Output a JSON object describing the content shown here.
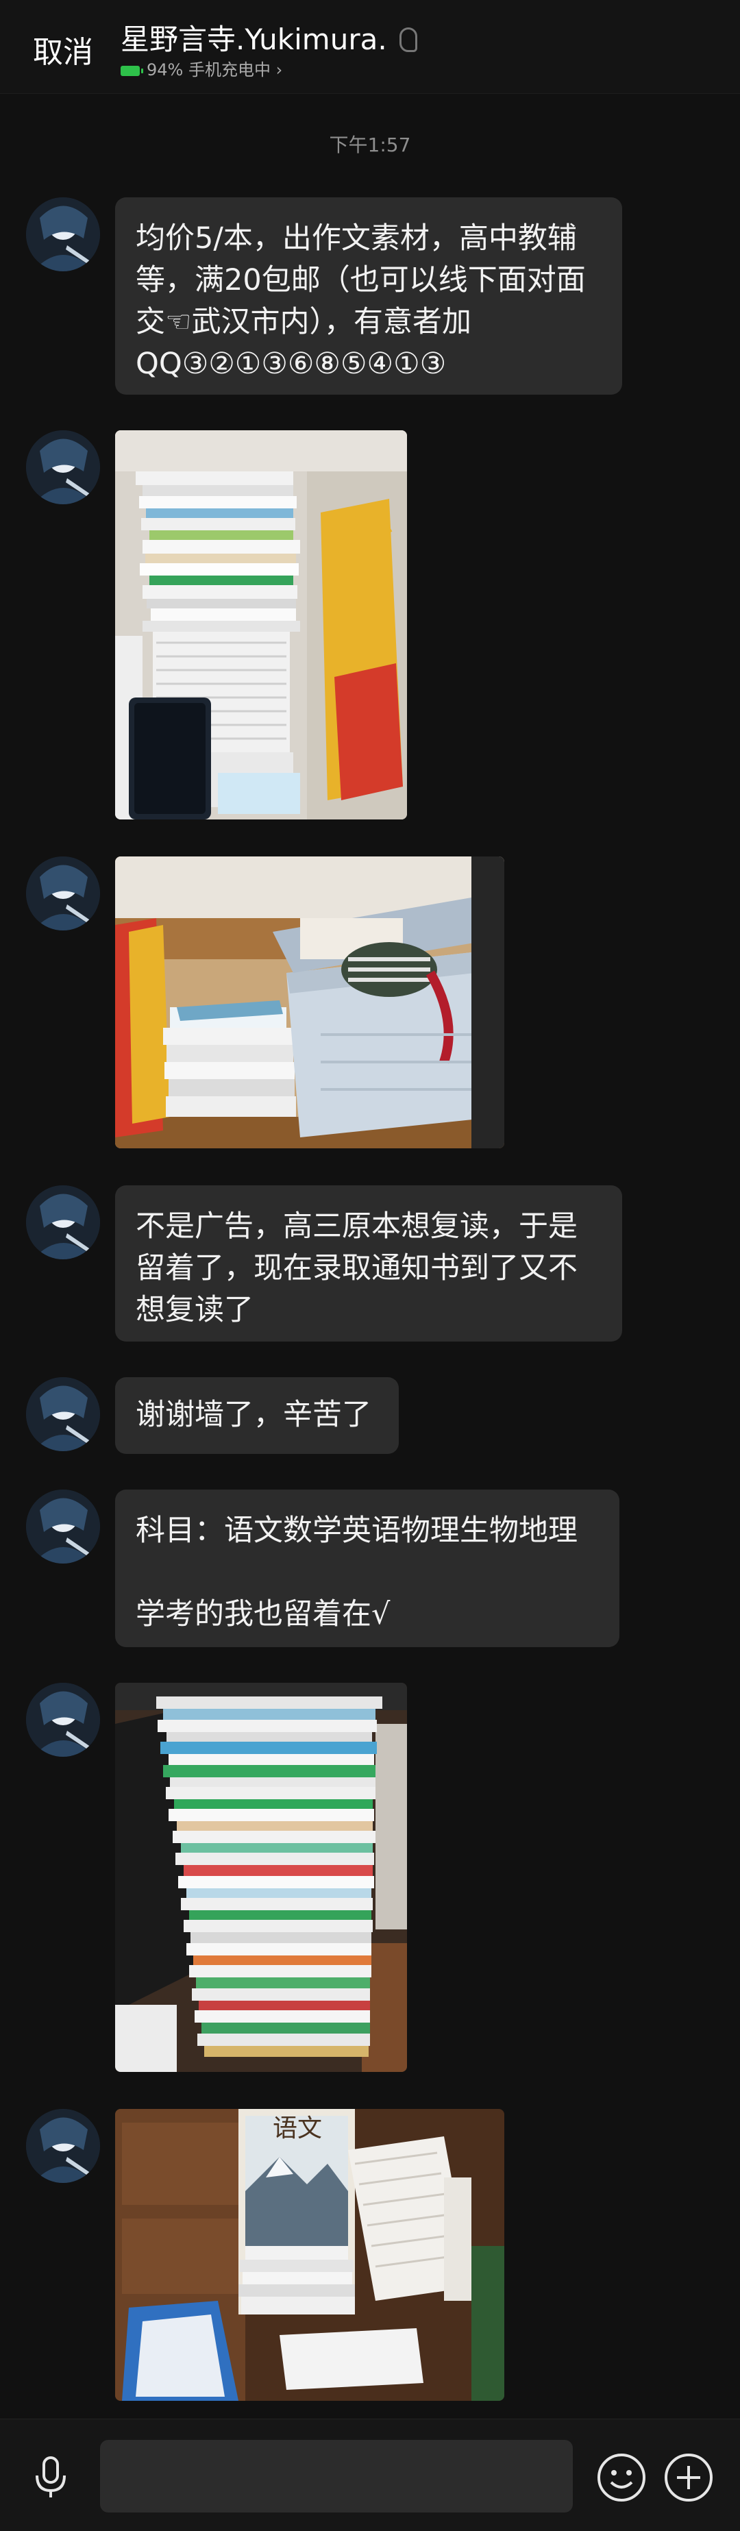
{
  "header": {
    "cancel_label": "取消",
    "title": "星野言寺.Yukimura.",
    "battery_text": "94%",
    "status_text": "手机充电中",
    "status_arrow": "›"
  },
  "timestamp": "下午1:57",
  "messages": [
    {
      "type": "text",
      "lines": [
        "均价5/本，出作文素材，高中教辅",
        "等，满20包邮（也可以线下面对面",
        "交☜武汉市内），有意者加",
        "QQ③②①③⑥⑧⑤④①③"
      ]
    },
    {
      "type": "image",
      "icon": "book-stack-photo-1"
    },
    {
      "type": "image",
      "icon": "book-box-photo"
    },
    {
      "type": "text",
      "lines": [
        "不是广告，高三原本想复读，于是",
        "留着了，现在录取通知书到了又不",
        "想复读了"
      ]
    },
    {
      "type": "text",
      "lines": [
        "谢谢墙了，辛苦了"
      ]
    },
    {
      "type": "text",
      "lines": [
        "科目：语文数学英语物理生物地理",
        "",
        "学考的我也留着在√"
      ]
    },
    {
      "type": "image",
      "icon": "book-stack-photo-2"
    },
    {
      "type": "image",
      "icon": "chinese-textbook-photo",
      "caption": "语文"
    }
  ],
  "bottom_bar": {
    "mic_icon": "microphone-icon",
    "emoji_icon": "emoji-icon",
    "plus_icon": "plus-icon"
  },
  "colors": {
    "background": "#111111",
    "bubble": "#2c2c2c",
    "battery": "#2ec14a",
    "timestamp": "#8e8e8e"
  }
}
